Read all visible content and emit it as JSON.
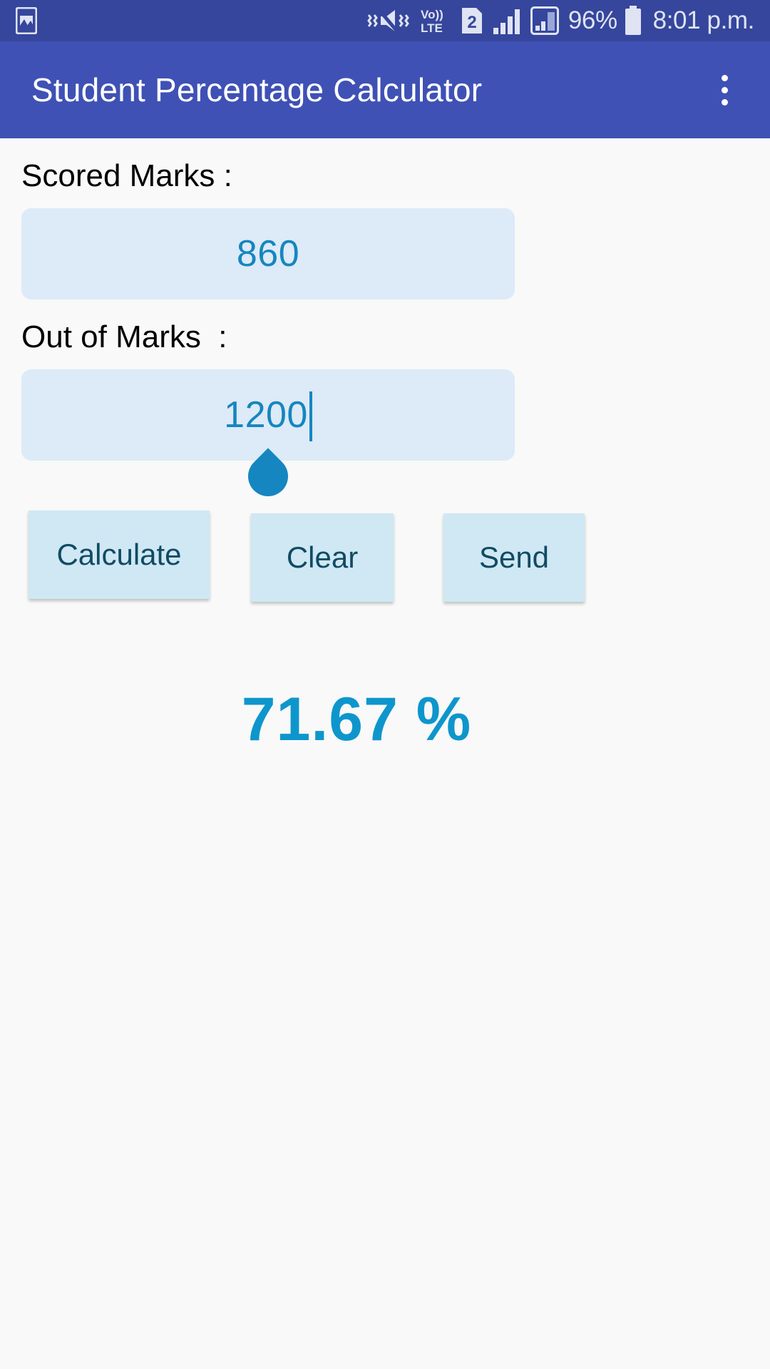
{
  "status_bar": {
    "background_color": "#35469c",
    "left_icons": [
      "image-icon"
    ],
    "right_icons": [
      "vibrate-mute-icon",
      "volte-icon",
      "sim-2-icon",
      "signal-bars-icon",
      "signal-box-icon",
      "battery-icon"
    ],
    "volte_top": "Vo))",
    "volte_bottom": "LTE",
    "sim_number": "2",
    "battery_percent": "96%",
    "time": "8:01 p.m."
  },
  "app_bar": {
    "title": "Student Percentage Calculator",
    "background_color": "#3f51b5",
    "overflow_menu": "more-options"
  },
  "form": {
    "scored_label": "Scored Marks :",
    "scored_value": "860",
    "scored_placeholder": "",
    "outof_label": "Out of Marks  :",
    "outof_value": "1200",
    "outof_placeholder": "",
    "field_background": "#ddeaf7",
    "value_color": "#1586c0"
  },
  "buttons": {
    "calculate": "Calculate",
    "clear": "Clear",
    "send": "Send",
    "background": "#cfe8f4",
    "text_color": "#114b63"
  },
  "result": {
    "text": "71.67 %",
    "color": "#0e96cc"
  }
}
